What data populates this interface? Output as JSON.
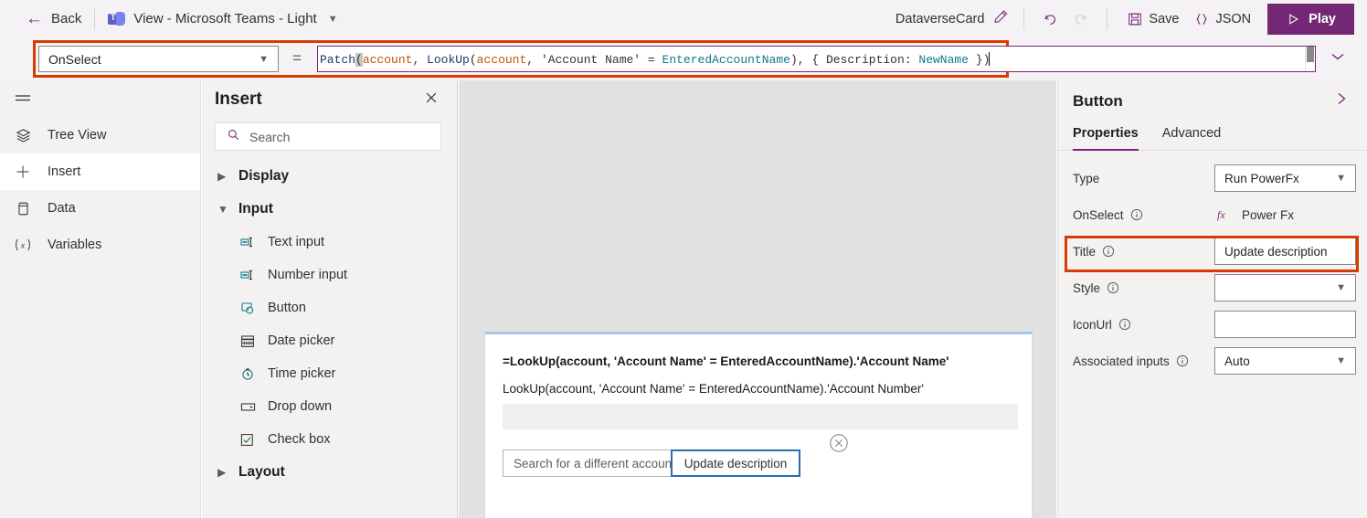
{
  "topbar": {
    "back_label": "Back",
    "back_icon": "arrow-left-icon",
    "app_icon": "microsoft-teams-icon",
    "view_label": "View - Microsoft Teams - Light",
    "view_chevron": "chevron-down-icon",
    "card_name": "DataverseCard",
    "rename_icon": "pencil-icon",
    "undo_icon": "undo-icon",
    "redo_icon": "redo-icon",
    "save_icon": "save-icon",
    "save_label": "Save",
    "json_icon": "braces-icon",
    "json_label": "JSON",
    "play_icon": "play-triangle-icon",
    "play_label": "Play",
    "accent_purple": "#742774",
    "highlight_orange": "#d83b01"
  },
  "formula_bar": {
    "property_selected": "OnSelect",
    "property_chevron": "chevron-down-icon",
    "equals": "=",
    "formula_plain": "Patch(account, LookUp(account, 'Account Name' = EnteredAccountName), { Description: NewName })",
    "tokens": {
      "fn_patch": "Patch",
      "paren_open_sel": "(",
      "tbl_account_1": "account",
      "sep1": ", ",
      "fn_lookup": "LookUp",
      "paren2": "(",
      "tbl_account_2": "account",
      "sep2": ", ",
      "str_account_name": "'Account Name'",
      "eq": " = ",
      "var_entered": "EnteredAccountName",
      "close1": "), { Description: ",
      "var_newname": "NewName",
      "close2": " })"
    },
    "expand_icon": "chevron-down-icon",
    "scrollbar": "vertical-scrollbar"
  },
  "rail": {
    "menu_icon": "hamburger-menu-icon",
    "items": [
      {
        "label": "Tree View",
        "icon": "layers-icon",
        "selected": false
      },
      {
        "label": "Insert",
        "icon": "plus-icon",
        "selected": true
      },
      {
        "label": "Data",
        "icon": "database-icon",
        "selected": false
      },
      {
        "label": "Variables",
        "icon": "variables-x-icon",
        "selected": false
      }
    ]
  },
  "insert_panel": {
    "title": "Insert",
    "close_icon": "close-icon",
    "search_icon": "search-icon",
    "search_placeholder": "Search",
    "search_value": "",
    "groups": [
      {
        "label": "Display",
        "expanded": false,
        "chevron": "chevron-right-icon",
        "items": []
      },
      {
        "label": "Input",
        "expanded": true,
        "chevron": "chevron-down-icon",
        "items": [
          {
            "label": "Text input",
            "icon": "text-input-icon"
          },
          {
            "label": "Number input",
            "icon": "number-input-icon"
          },
          {
            "label": "Button",
            "icon": "button-icon"
          },
          {
            "label": "Date picker",
            "icon": "calendar-icon"
          },
          {
            "label": "Time picker",
            "icon": "clock-icon"
          },
          {
            "label": "Drop down",
            "icon": "dropdown-icon"
          },
          {
            "label": "Check box",
            "icon": "checkbox-icon"
          }
        ]
      },
      {
        "label": "Layout",
        "expanded": false,
        "chevron": "chevron-right-icon",
        "items": []
      }
    ]
  },
  "canvas": {
    "card": {
      "line1": "=LookUp(account, 'Account Name' = EnteredAccountName).'Account Name'",
      "line2": "LookUp(account, 'Account Name' = EnteredAccountName).'Account Number'",
      "input_value": "",
      "buttons": [
        {
          "label": "Search for a different account",
          "selected": false
        },
        {
          "label": "Update description",
          "selected": true
        }
      ],
      "delete_handle_icon": "circle-x-icon"
    }
  },
  "right_panel": {
    "title": "Button",
    "collapse_icon": "chevron-right-icon",
    "tabs": [
      {
        "label": "Properties",
        "selected": true
      },
      {
        "label": "Advanced",
        "selected": false
      }
    ],
    "properties": [
      {
        "name": "Type",
        "info": false,
        "control": "select",
        "value": "Run PowerFx",
        "chevron": "chevron-down-icon"
      },
      {
        "name": "OnSelect",
        "info": true,
        "control": "powerfx",
        "value": "Power Fx",
        "icon": "fx-icon"
      },
      {
        "name": "Title",
        "info": true,
        "control": "text",
        "value": "Update description",
        "highlighted": true
      },
      {
        "name": "Style",
        "info": true,
        "control": "select",
        "value": "",
        "chevron": "chevron-down-icon"
      },
      {
        "name": "IconUrl",
        "info": true,
        "control": "text",
        "value": ""
      },
      {
        "name": "Associated inputs",
        "info": true,
        "control": "select",
        "value": "Auto",
        "chevron": "chevron-down-icon"
      }
    ]
  }
}
